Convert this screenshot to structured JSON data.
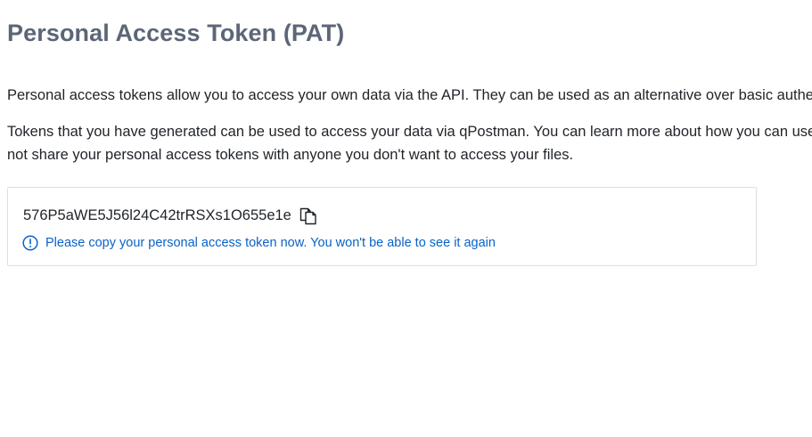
{
  "page": {
    "title": "Personal Access Token (PAT)",
    "intro_paragraph": "Personal access tokens allow you to access your own data via the API. They can be used as an alternative over basic authent",
    "usage_paragraph_line1": "Tokens that you have generated can be used to access your data via qPostman. You can learn more about how you can use y",
    "usage_paragraph_line2": "not share your personal access tokens with anyone you don't want to access your files."
  },
  "token_panel": {
    "token_value": "576P5aWE5J56l24C42trRSXs1O655e1e",
    "copy_icon": "copy-icon",
    "notice_icon": "info-circle-icon",
    "notice_text": "Please copy your personal access token now. You won't be able to see it again"
  },
  "colors": {
    "title": "#5c6677",
    "text": "#1f2328",
    "notice": "#0a62c8",
    "border": "#dcdfe3"
  }
}
